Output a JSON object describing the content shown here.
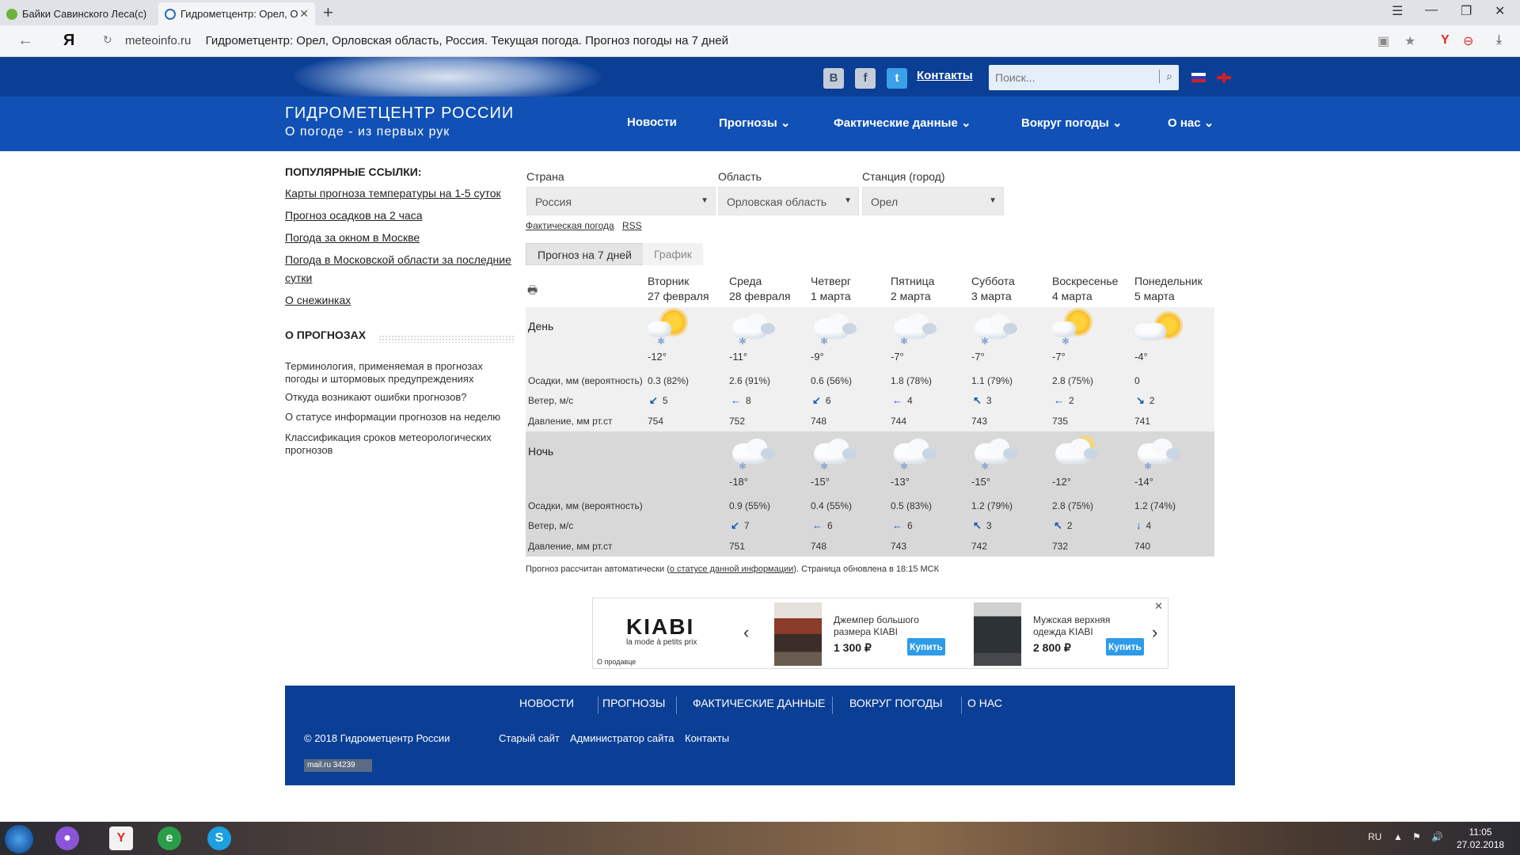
{
  "browser": {
    "tabs": [
      {
        "title": "Байки Савинского Леса(с)"
      },
      {
        "title": "Гидрометцентр: Орел, О"
      }
    ],
    "new_tab": "+",
    "address_domain": "meteoinfo.ru",
    "address_title": "Гидрометцентр: Орел, Орловская область, Россия. Текущая погода. Прогноз погоды на 7 дней",
    "yandex_glyph": "Я"
  },
  "header": {
    "contacts": "Контакты",
    "search_placeholder": "Поиск...",
    "logo_title": "ГИДРОМЕТЦЕНТР РОССИИ",
    "logo_subtitle": "О погоде - из первых рук",
    "nav": [
      {
        "label": "Новости"
      },
      {
        "label": "Прогнозы ⌄"
      },
      {
        "label": "Фактические данные ⌄"
      },
      {
        "label": "Вокруг погоды ⌄"
      },
      {
        "label": "О нас ⌄"
      }
    ]
  },
  "sidebar": {
    "popular_heading": "ПОПУЛЯРНЫЕ ССЫЛКИ:",
    "popular_links": [
      "Карты прогноза температуры на 1-5 суток",
      "Прогноз осадков на 2 часа",
      "Погода за окном в Москве",
      "Погода в Московской области за последние сутки",
      "О снежинках"
    ],
    "forecasts_heading": "О ПРОГНОЗАХ",
    "forecast_items": [
      "Терминология, применяемая в прогнозах погоды и штормовых предупреждениях",
      "Откуда возникают ошибки прогнозов?",
      "О статусе информации прогнозов на неделю",
      "Классификация сроков метеорологических прогнозов"
    ]
  },
  "selectors": {
    "country_label": "Страна",
    "country_value": "Россия",
    "region_label": "Область",
    "region_value": "Орловская область",
    "station_label": "Станция (город)",
    "station_value": "Орел",
    "actual_link": "Фактическая погода",
    "rss_link": "RSS"
  },
  "tabs": {
    "active": "Прогноз на 7 дней",
    "inactive": "График"
  },
  "forecast": {
    "days": [
      {
        "name": "Вторник",
        "date": "27 февраля"
      },
      {
        "name": "Среда",
        "date": "28 февраля"
      },
      {
        "name": "Четверг",
        "date": "1 марта"
      },
      {
        "name": "Пятница",
        "date": "2 марта"
      },
      {
        "name": "Суббота",
        "date": "3 марта"
      },
      {
        "name": "Воскресенье",
        "date": "4 марта"
      },
      {
        "name": "Понедельник",
        "date": "5 марта"
      }
    ],
    "day_label": "День",
    "night_label": "Ночь",
    "precip_label": "Осадки, мм (вероятность)",
    "wind_label": "Ветер, м/с",
    "pressure_label": "Давление, мм рт.ст",
    "day": {
      "icons": [
        "sun-cloud-snow",
        "cloud-snow",
        "cloud-snow",
        "cloud-snow",
        "cloud-snow",
        "sun-cloud-snow",
        "sun-cloud"
      ],
      "temps": [
        "-12°",
        "-11°",
        "-9°",
        "-7°",
        "-7°",
        "-7°",
        "-4°"
      ],
      "precip": [
        "0.3 (82%)",
        "2.6 (91%)",
        "0.6 (56%)",
        "1.8 (78%)",
        "1.1 (79%)",
        "2.8 (75%)",
        "0"
      ],
      "wind_arrows": [
        "↙",
        "←",
        "↙",
        "←",
        "↖",
        "←",
        "↘"
      ],
      "wind": [
        "5",
        "8",
        "6",
        "4",
        "3",
        "2",
        "2"
      ],
      "pressure": [
        "754",
        "752",
        "748",
        "744",
        "743",
        "735",
        "741"
      ]
    },
    "night": {
      "icons": [
        "cloud-snow",
        "cloud-snow",
        "cloud-snow",
        "cloud-snow",
        "moon-cloud",
        "cloud-snow"
      ],
      "temps": [
        "-18°",
        "-15°",
        "-13°",
        "-15°",
        "-12°",
        "-14°"
      ],
      "precip": [
        "0.9 (55%)",
        "0.4 (55%)",
        "0.5 (83%)",
        "1.2 (79%)",
        "2.8 (75%)",
        "1.2 (74%)"
      ],
      "wind_arrows": [
        "↙",
        "←",
        "←",
        "↖",
        "↖",
        "↓"
      ],
      "wind": [
        "7",
        "6",
        "6",
        "3",
        "2",
        "4"
      ],
      "pressure": [
        "751",
        "748",
        "743",
        "742",
        "732",
        "740"
      ]
    },
    "footnote_prefix": "Прогноз рассчитан автоматически (",
    "footnote_link": "о статусе данной информации",
    "footnote_suffix": "). Страница обновлена в 18:15 МСК"
  },
  "ad": {
    "brand": "KIABI",
    "brand_sub": "la mode à petits prix",
    "seller": "О продавце",
    "items": [
      {
        "title": "Джемпер большого размера KIABI",
        "price": "1 300 ₽",
        "buy": "Купить"
      },
      {
        "title": "Мужская верхняя одежда KIABI",
        "price": "2 800 ₽",
        "buy": "Купить"
      }
    ]
  },
  "footer": {
    "nav": [
      "НОВОСТИ",
      "ПРОГНОЗЫ",
      "ФАКТИЧЕСКИЕ ДАННЫЕ",
      "ВОКРУГ ПОГОДЫ",
      "О НАС"
    ],
    "copyright": "© 2018 Гидрометцентр России",
    "links": [
      "Старый сайт",
      "Администратор сайта",
      "Контакты"
    ],
    "counter": "mail.ru  34239"
  },
  "taskbar": {
    "lang": "RU",
    "time": "11:05",
    "date": "27.02.2018"
  }
}
